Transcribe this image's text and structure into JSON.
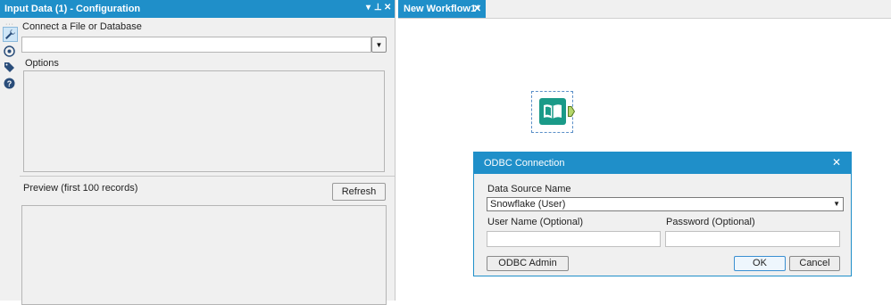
{
  "config_panel": {
    "title": "Input Data (1) - Configuration",
    "controls": {
      "dropdown": "▾",
      "pin": "⊥",
      "close": "✕"
    },
    "connect_label": "Connect a File or Database",
    "connect_value": "",
    "options_label": "Options",
    "preview_label": "Preview (first 100 records)",
    "refresh_label": "Refresh"
  },
  "tabs": [
    {
      "label": "New Workflow1*",
      "close": "✕"
    }
  ],
  "canvas": {
    "tool": {
      "name": "Input Data",
      "icon": "book-icon",
      "color": "#1a9a88"
    }
  },
  "dialog": {
    "title": "ODBC Connection",
    "close": "✕",
    "dsn_label": "Data Source Name",
    "dsn_value": "Snowflake   (User)",
    "username_label": "User Name (Optional)",
    "username_value": "",
    "password_label": "Password (Optional)",
    "password_value": "",
    "odbc_admin_label": "ODBC Admin",
    "ok_label": "OK",
    "cancel_label": "Cancel"
  },
  "colors": {
    "accent": "#1f8fc9",
    "tool": "#1a9a88"
  }
}
